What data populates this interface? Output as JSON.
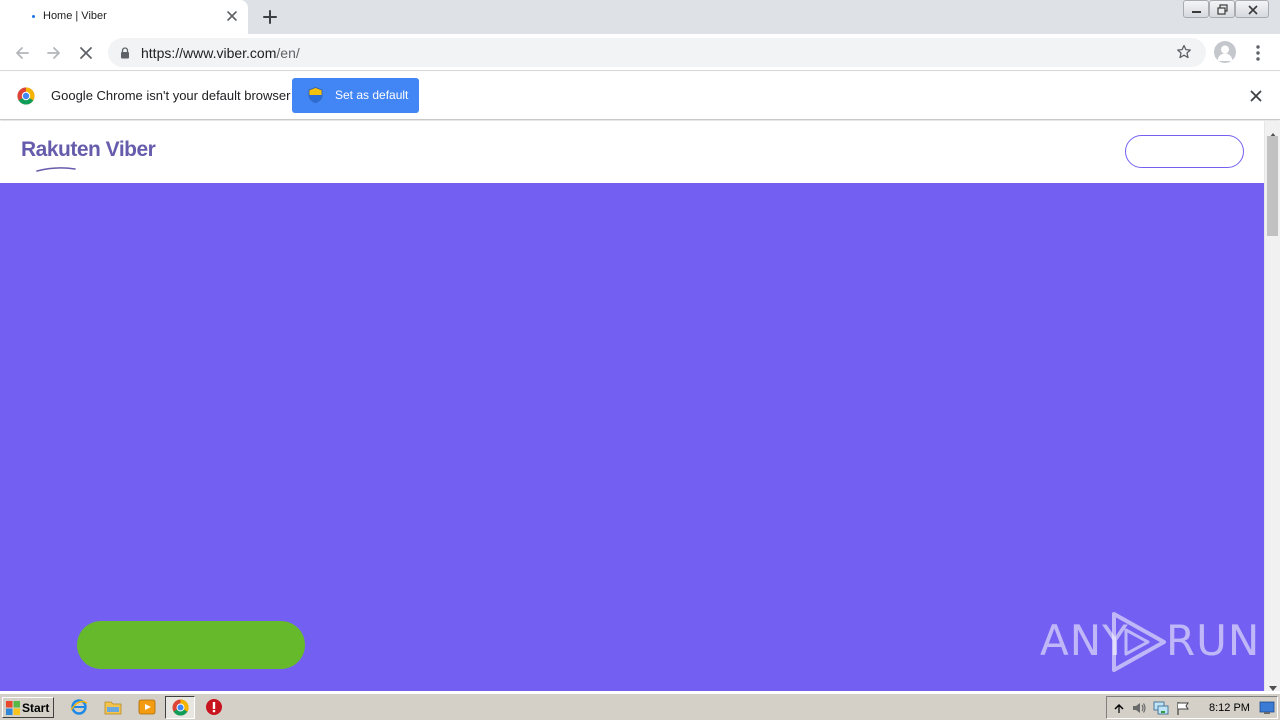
{
  "browser": {
    "tab": {
      "title": "Home | Viber"
    },
    "url": {
      "scheme_host": "https://www.viber.com",
      "path": "/en/"
    },
    "infobar": {
      "message": "Google Chrome isn't your default browser",
      "button_label": "Set as default"
    }
  },
  "page": {
    "logo_text": "Rakuten Viber",
    "brand_color": "#7360f2",
    "logo_color": "#665cac",
    "cta_color": "#66b92a"
  },
  "watermark": {
    "left": "ANY",
    "right": "RUN"
  },
  "taskbar": {
    "start_label": "Start",
    "clock": "8:12 PM"
  }
}
